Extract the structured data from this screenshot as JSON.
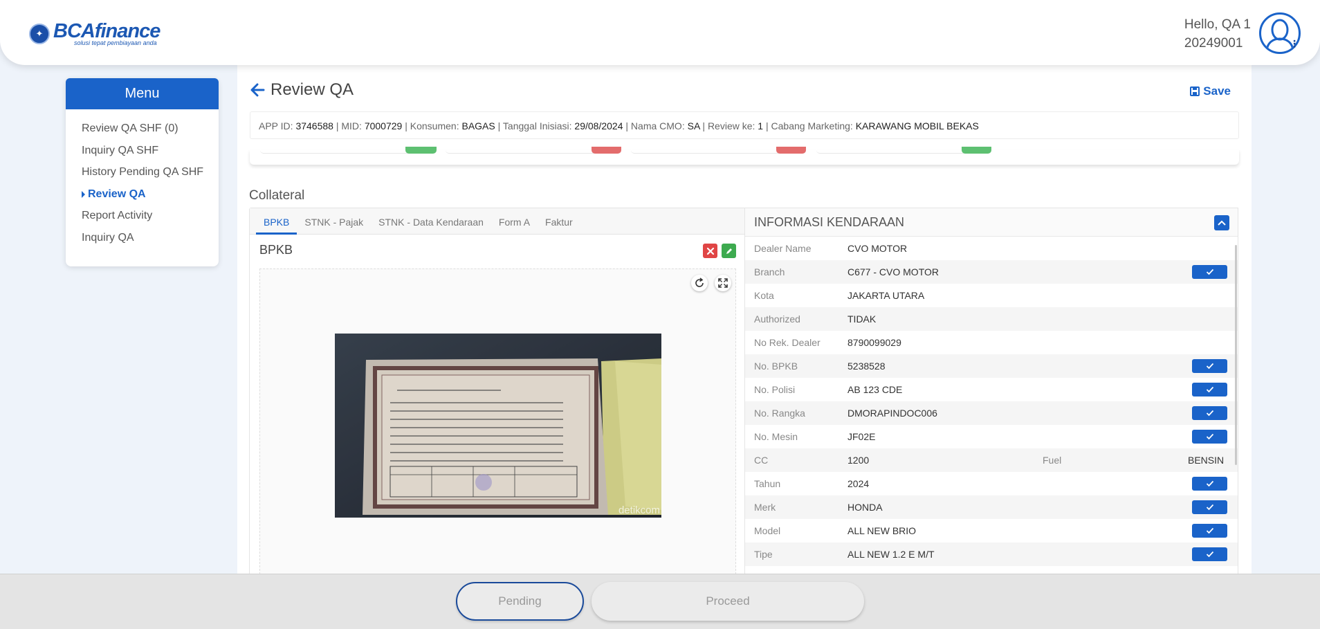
{
  "brand": {
    "logo_main": "BCAfinance",
    "logo_tagline": "solusi tepat pembiayaan anda"
  },
  "user": {
    "greeting": "Hello, QA 1",
    "id": "20249001"
  },
  "sidebar": {
    "title": "Menu",
    "items": [
      {
        "label": "Review QA SHF (0)"
      },
      {
        "label": "Inquiry QA SHF"
      },
      {
        "label": "History Pending QA SHF"
      },
      {
        "label": "Review QA"
      },
      {
        "label": "Report Activity"
      },
      {
        "label": "Inquiry QA"
      }
    ],
    "active_index": 3
  },
  "page": {
    "title": "Review QA",
    "save_label": "Save"
  },
  "info_bar": {
    "app_id_label": "APP ID:",
    "app_id": "3746588",
    "mid_label": "MID:",
    "mid": "7000729",
    "konsumen_label": "Konsumen:",
    "konsumen": "BAGAS",
    "tanggal_label": "Tanggal Inisiasi:",
    "tanggal": "29/08/2024",
    "cmo_label": "Nama CMO:",
    "cmo": "SA",
    "review_label": "Review ke:",
    "review": "1",
    "cabang_label": "Cabang Marketing:",
    "cabang": "KARAWANG MOBIL BEKAS"
  },
  "collateral": {
    "title": "Collateral",
    "tabs": [
      "BPKB",
      "STNK - Pajak",
      "STNK - Data Kendaraan",
      "Form A",
      "Faktur"
    ],
    "active_tab": 0,
    "doc_title": "BPKB",
    "photo_watermark": "detikcom"
  },
  "vehicle_info": {
    "title": "INFORMASI KENDARAAN",
    "rows": [
      {
        "label": "Dealer Name",
        "value": "CVO MOTOR",
        "checked": false
      },
      {
        "label": "Branch",
        "value": "C677 - CVO MOTOR",
        "checked": true
      },
      {
        "label": "Kota",
        "value": "JAKARTA UTARA",
        "checked": false
      },
      {
        "label": "Authorized",
        "value": "TIDAK",
        "checked": false
      },
      {
        "label": "No Rek. Dealer",
        "value": "8790099029",
        "checked": false
      },
      {
        "label": "No. BPKB",
        "value": "5238528",
        "checked": true
      },
      {
        "label": "No. Polisi",
        "value": "AB 123 CDE",
        "checked": true
      },
      {
        "label": "No. Rangka",
        "value": "DMORAPINDOC006",
        "checked": true
      },
      {
        "label": "No. Mesin",
        "value": "JF02E",
        "checked": true
      },
      {
        "label": "CC",
        "value": "1200",
        "label2": "Fuel",
        "value2": "BENSIN",
        "checked": false
      },
      {
        "label": "Tahun",
        "value": "2024",
        "checked": true
      },
      {
        "label": "Merk",
        "value": "HONDA",
        "checked": true
      },
      {
        "label": "Model",
        "value": "ALL NEW BRIO",
        "checked": true
      },
      {
        "label": "Tipe",
        "value": "ALL NEW 1.2 E M/T",
        "checked": true
      }
    ]
  },
  "footer": {
    "pending_label": "Pending",
    "proceed_label": "Proceed"
  },
  "colors": {
    "primary": "#1a63c9",
    "danger": "#e04545",
    "success": "#3daa4f"
  }
}
